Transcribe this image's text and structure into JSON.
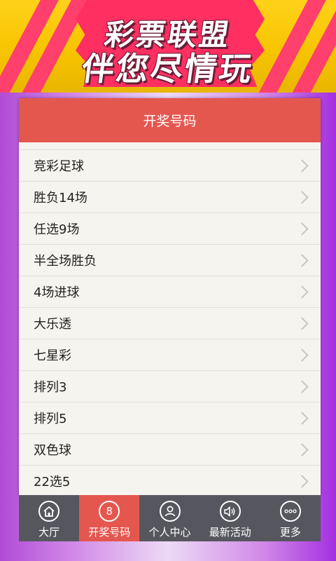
{
  "banner": {
    "line1": "彩票联盟",
    "line2": "伴您尽情玩"
  },
  "panel": {
    "title": "开奖号码",
    "items": [
      {
        "label": "竞彩足球"
      },
      {
        "label": "胜负14场"
      },
      {
        "label": "任选9场"
      },
      {
        "label": "半全场胜负"
      },
      {
        "label": "4场进球"
      },
      {
        "label": "大乐透"
      },
      {
        "label": "七星彩"
      },
      {
        "label": "排列3"
      },
      {
        "label": "排列5"
      },
      {
        "label": "双色球"
      },
      {
        "label": "22选5"
      }
    ]
  },
  "tabbar": {
    "tabs": [
      {
        "label": "大厅",
        "icon": "home-icon"
      },
      {
        "label": "开奖号码",
        "icon": "lottery-ball-icon",
        "glyph": "8",
        "active": true
      },
      {
        "label": "个人中心",
        "icon": "user-icon"
      },
      {
        "label": "最新活动",
        "icon": "speaker-icon"
      },
      {
        "label": "更多",
        "icon": "more-icon"
      }
    ]
  },
  "colors": {
    "accent": "#e4574f",
    "tabbar": "#56575e",
    "banner_yellow": "#f7c400",
    "banner_pink": "#ff2f61",
    "background_purple": "#b04bd6"
  }
}
